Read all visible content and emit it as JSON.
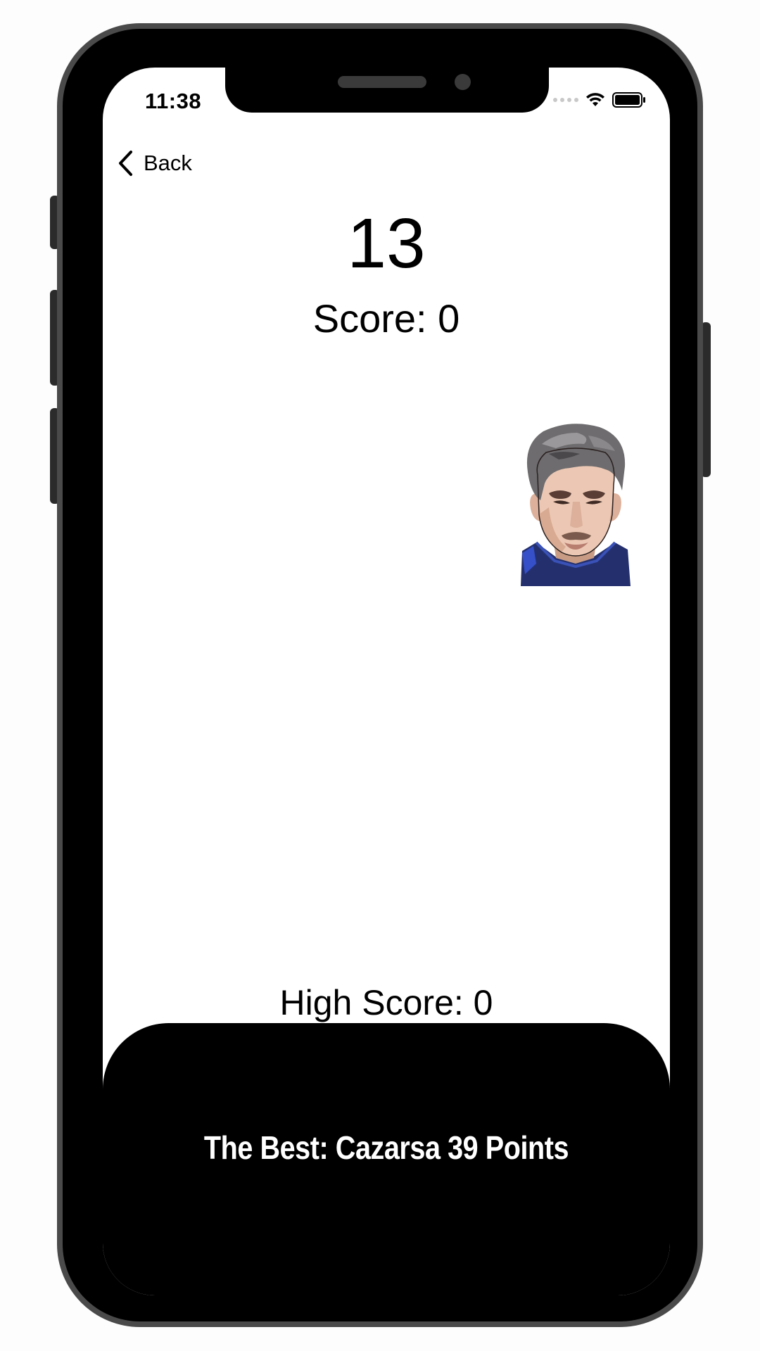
{
  "status_bar": {
    "time": "11:38",
    "icons": [
      "signal-dots-icon",
      "wifi-icon",
      "battery-icon"
    ]
  },
  "nav": {
    "back_label": "Back",
    "back_icon": "chevron-left-icon"
  },
  "game": {
    "counter": "13",
    "score": "Score: 0",
    "target_image": "player-face-image",
    "high_score": "High Score: 0"
  },
  "banner": {
    "text": "The Best: Cazarsa 39 Points"
  },
  "colors": {
    "background": "#ffffff",
    "text": "#000000",
    "banner_bg": "#000000",
    "banner_text": "#ffffff",
    "phone_frame": "#4a4a4a"
  }
}
